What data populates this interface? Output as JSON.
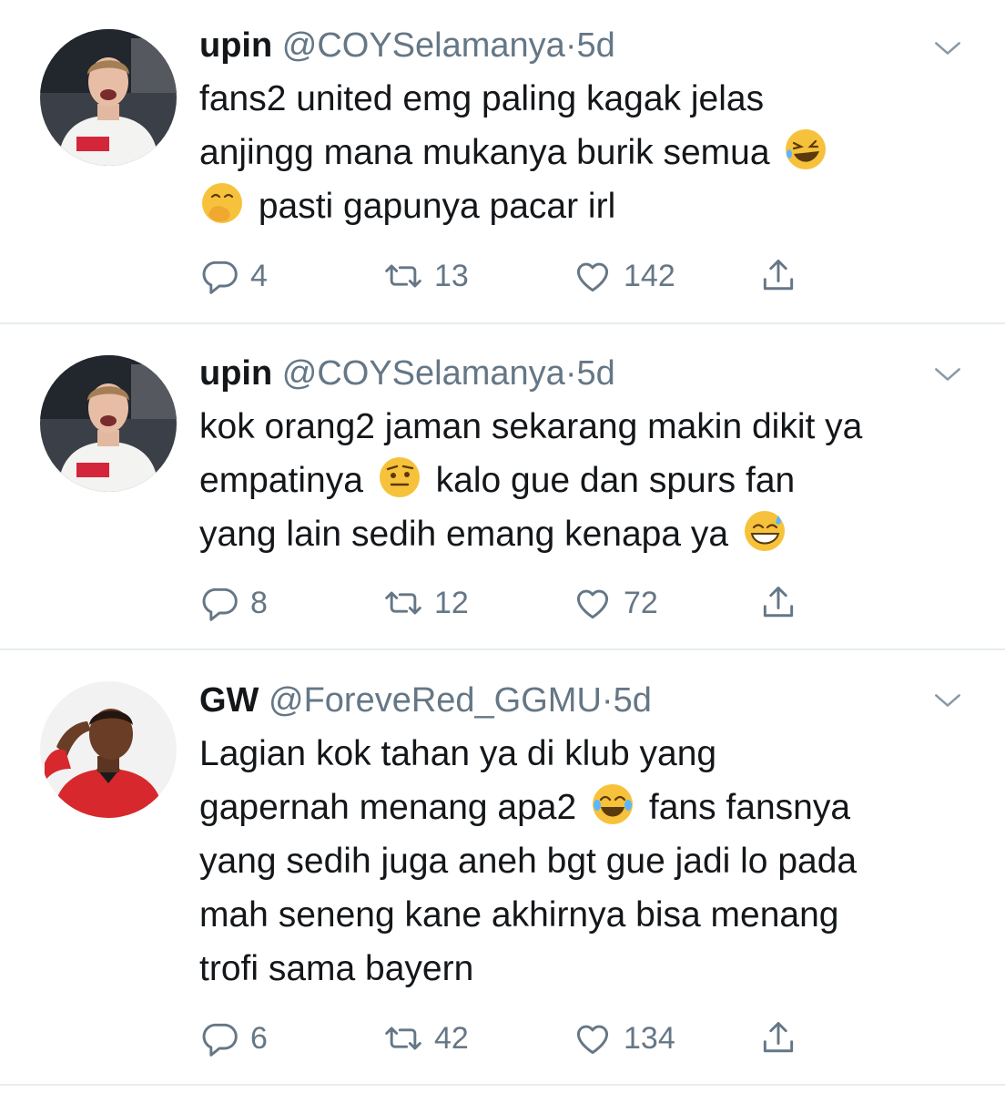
{
  "tweets": [
    {
      "name": "upin",
      "handle": "@COYSelamanya",
      "dot": "·",
      "time": "5d",
      "lines": [
        "fans2 united emg paling kagak jelas",
        "anjingg mana mukanya burik semua",
        "pasti gapunya pacar irl"
      ],
      "emojis": [
        "rolling-on-floor-laughing",
        "face-with-hand-over-mouth"
      ],
      "replies": "4",
      "retweets": "13",
      "likes": "142"
    },
    {
      "name": "upin",
      "handle": "@COYSelamanya",
      "dot": "·",
      "time": "5d",
      "lines": [
        "kok orang2 jaman sekarang makin dikit ya",
        "empatinya",
        "kalo gue dan spurs fan",
        "yang lain sedih emang kenapa ya"
      ],
      "emojis": [
        "face-with-raised-eyebrow",
        "grinning-face-with-sweat"
      ],
      "replies": "8",
      "retweets": "12",
      "likes": "72"
    },
    {
      "name": "GW",
      "handle": "@ForeveRed_GGMU",
      "dot": "·",
      "time": "5d",
      "lines": [
        "Lagian kok tahan ya di klub yang",
        "gapernah menang apa2",
        "fans fansnya",
        "yang sedih juga aneh bgt gue jadi lo pada",
        "mah seneng kane akhirnya bisa menang",
        "trofi sama bayern"
      ],
      "emojis": [
        "face-with-tears-of-joy"
      ],
      "replies": "6",
      "retweets": "42",
      "likes": "134"
    }
  ],
  "colors": {
    "text": "#14171a",
    "muted": "#657786",
    "divider": "#e6ecf0",
    "emoji": "#f7c23b"
  },
  "icons": [
    "reply-icon",
    "retweet-icon",
    "like-icon",
    "share-icon",
    "chevron-down-icon"
  ]
}
